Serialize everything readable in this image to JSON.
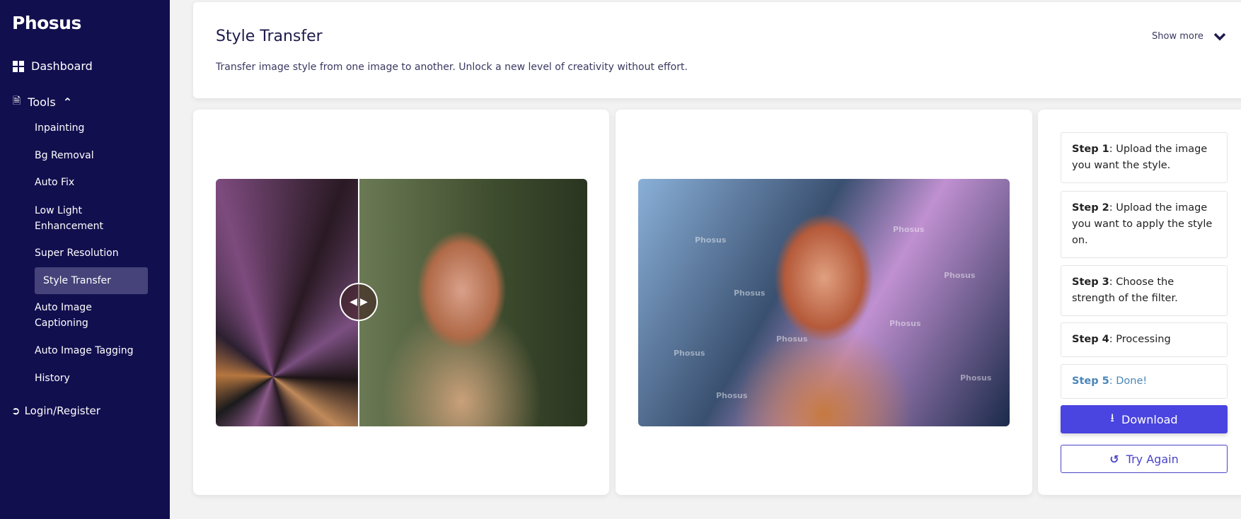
{
  "app": {
    "logo": "Phosus"
  },
  "sidebar": {
    "dashboard": "Dashboard",
    "tools": "Tools",
    "items": [
      {
        "label": "Inpainting"
      },
      {
        "label": "Bg Removal"
      },
      {
        "label": "Auto Fix"
      },
      {
        "label": "Low Light Enhancement"
      },
      {
        "label": "Super Resolution"
      },
      {
        "label": "Style Transfer",
        "active": true
      },
      {
        "label": "Auto Image Captioning"
      },
      {
        "label": "Auto Image Tagging"
      },
      {
        "label": "History"
      }
    ],
    "login": "Login/Register"
  },
  "header": {
    "title": "Style Transfer",
    "description": "Transfer image style from one image to another. Unlock a new level of creativity without effort.",
    "show_more": "Show more"
  },
  "watermark": "Phosus",
  "steps": [
    {
      "label": "Step 1",
      "text": ": Upload the image you want the style."
    },
    {
      "label": "Step 2",
      "text": ": Upload the image you want to apply the style on."
    },
    {
      "label": "Step 3",
      "text": ": Choose the strength of the filter."
    },
    {
      "label": "Step 4",
      "text": ": Processing"
    },
    {
      "label": "Step 5",
      "text": ": Done!"
    }
  ],
  "buttons": {
    "download": "Download",
    "try_again": "Try Again"
  },
  "colors": {
    "sidebar": "#120f4f",
    "accent": "#4a44e0",
    "active_item": "#45437a",
    "done_step": "#4a86b8"
  }
}
